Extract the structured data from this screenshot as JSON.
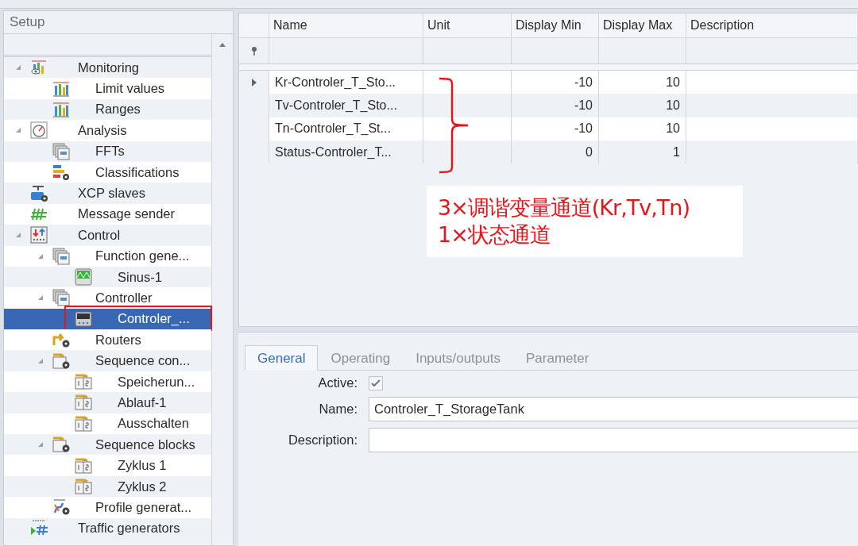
{
  "setup_panel": {
    "title": "Setup"
  },
  "tree": [
    {
      "label": "Monitoring",
      "kind": "monitor",
      "expanded": true,
      "selected": false,
      "children": [
        {
          "label": "Limit values",
          "kind": "bars",
          "selected": false
        },
        {
          "label": "Ranges",
          "kind": "bars",
          "selected": false
        }
      ]
    },
    {
      "label": "Analysis",
      "kind": "gauge",
      "expanded": true,
      "selected": false,
      "children": [
        {
          "label": "FFTs",
          "kind": "stack",
          "selected": false
        },
        {
          "label": "Classifications",
          "kind": "classify",
          "selected": false
        }
      ]
    },
    {
      "label": "XCP slaves",
      "kind": "xcp",
      "selected": false
    },
    {
      "label": "Message sender",
      "kind": "hash",
      "selected": false
    },
    {
      "label": "Control",
      "kind": "control",
      "expanded": true,
      "selected": false,
      "children": [
        {
          "label": "Function gene...",
          "kind": "stack",
          "expanded": true,
          "selected": false,
          "children": [
            {
              "label": "Sinus-1",
              "kind": "screen",
              "selected": false
            }
          ]
        },
        {
          "label": "Controller",
          "kind": "stack",
          "expanded": true,
          "selected": false,
          "children": [
            {
              "label": "Controler_...",
              "kind": "device",
              "selected": true
            }
          ]
        },
        {
          "label": "Routers",
          "kind": "router",
          "selected": false
        },
        {
          "label": "Sequence con...",
          "kind": "sequence",
          "expanded": true,
          "selected": false,
          "children": [
            {
              "label": "Speicherun...",
              "kind": "step",
              "selected": false
            },
            {
              "label": "Ablauf-1",
              "kind": "step",
              "selected": false
            },
            {
              "label": "Ausschalten",
              "kind": "step",
              "selected": false
            }
          ]
        },
        {
          "label": "Sequence blocks",
          "kind": "sequence",
          "expanded": true,
          "selected": false,
          "children": [
            {
              "label": "Zyklus 1",
              "kind": "step",
              "selected": false
            },
            {
              "label": "Zyklus 2",
              "kind": "step",
              "selected": false
            }
          ]
        },
        {
          "label": "Profile generat...",
          "kind": "profile",
          "selected": false
        }
      ]
    },
    {
      "label": "Traffic generators",
      "kind": "traffic",
      "selected": false
    }
  ],
  "table": {
    "columns": [
      "Name",
      "Unit",
      "Display Min",
      "Display Max",
      "Description"
    ],
    "rows": [
      {
        "name": "Kr-Controler_T_Sto...",
        "display_min": "-10",
        "display_max": "10",
        "current": true
      },
      {
        "name": "Tv-Controler_T_Sto...",
        "display_min": "-10",
        "display_max": "10",
        "current": false
      },
      {
        "name": "Tn-Controler_T_St...",
        "display_min": "-10",
        "display_max": "10",
        "current": false
      },
      {
        "name": "Status-Controler_T...",
        "display_min": "0",
        "display_max": "1",
        "current": false
      }
    ]
  },
  "annotation": {
    "lines": [
      "3×调谐变量通道(Kr,Tv,Tn)",
      "1×状态通道"
    ]
  },
  "details": {
    "tabs": [
      {
        "label": "General",
        "selected": true
      },
      {
        "label": "Operating",
        "selected": false
      },
      {
        "label": "Inputs/outputs",
        "selected": false
      },
      {
        "label": "Parameter",
        "selected": false
      }
    ],
    "active": {
      "label": "Active:",
      "checked": true
    },
    "name": {
      "label": "Name:",
      "value": "Controler_T_StorageTank"
    },
    "description": {
      "label": "Description:"
    }
  }
}
